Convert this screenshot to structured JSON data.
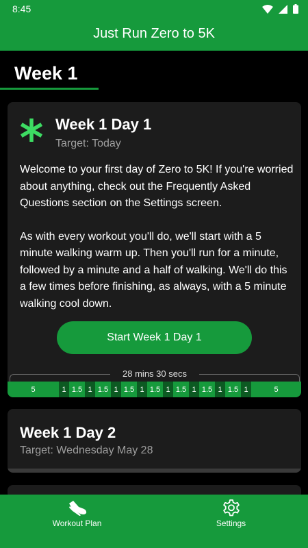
{
  "status": {
    "time": "8:45"
  },
  "app": {
    "title": "Just Run Zero to 5K"
  },
  "week_tab": {
    "label": "Week 1"
  },
  "day1": {
    "title": "Week 1 Day 1",
    "target": "Target: Today",
    "paragraph1": "Welcome to your first day of Zero to 5K! If you're worried about anything, check out the Frequently Asked Questions section on the Settings screen.",
    "paragraph2": "As with every workout you'll do, we'll start with a 5 minute walking warm up. Then you'll run for a minute, followed by a minute and a half of walking. We'll do this a few times before finishing, as always, with a 5 minute walking cool down.",
    "start_button": "Start Week 1 Day 1",
    "total_duration": "28 mins 30 secs",
    "segments": [
      {
        "kind": "walk",
        "minutes": 5,
        "label": "5"
      },
      {
        "kind": "run",
        "minutes": 1,
        "label": "1"
      },
      {
        "kind": "walk",
        "minutes": 1.5,
        "label": "1.5"
      },
      {
        "kind": "run",
        "minutes": 1,
        "label": "1"
      },
      {
        "kind": "walk",
        "minutes": 1.5,
        "label": "1.5"
      },
      {
        "kind": "run",
        "minutes": 1,
        "label": "1"
      },
      {
        "kind": "walk",
        "minutes": 1.5,
        "label": "1.5"
      },
      {
        "kind": "run",
        "minutes": 1,
        "label": "1"
      },
      {
        "kind": "walk",
        "minutes": 1.5,
        "label": "1.5"
      },
      {
        "kind": "run",
        "minutes": 1,
        "label": "1"
      },
      {
        "kind": "walk",
        "minutes": 1.5,
        "label": "1.5"
      },
      {
        "kind": "run",
        "minutes": 1,
        "label": "1"
      },
      {
        "kind": "walk",
        "minutes": 1.5,
        "label": "1.5"
      },
      {
        "kind": "run",
        "minutes": 1,
        "label": "1"
      },
      {
        "kind": "walk",
        "minutes": 1.5,
        "label": "1.5"
      },
      {
        "kind": "run",
        "minutes": 1,
        "label": "1"
      },
      {
        "kind": "walk",
        "minutes": 5,
        "label": "5"
      }
    ]
  },
  "day2": {
    "title": "Week 1 Day 2",
    "target": "Target: Wednesday May 28"
  },
  "bottom_nav": {
    "workout_plan": {
      "label": "Workout Plan",
      "icon": "running-shoe-icon"
    },
    "settings": {
      "label": "Settings",
      "icon": "gear-icon"
    }
  },
  "colors": {
    "brand_green": "#169a3c",
    "run_segment": "#0c5a22",
    "card_background": "#1c1c1c",
    "accent_asterisk": "#3ddc63"
  }
}
